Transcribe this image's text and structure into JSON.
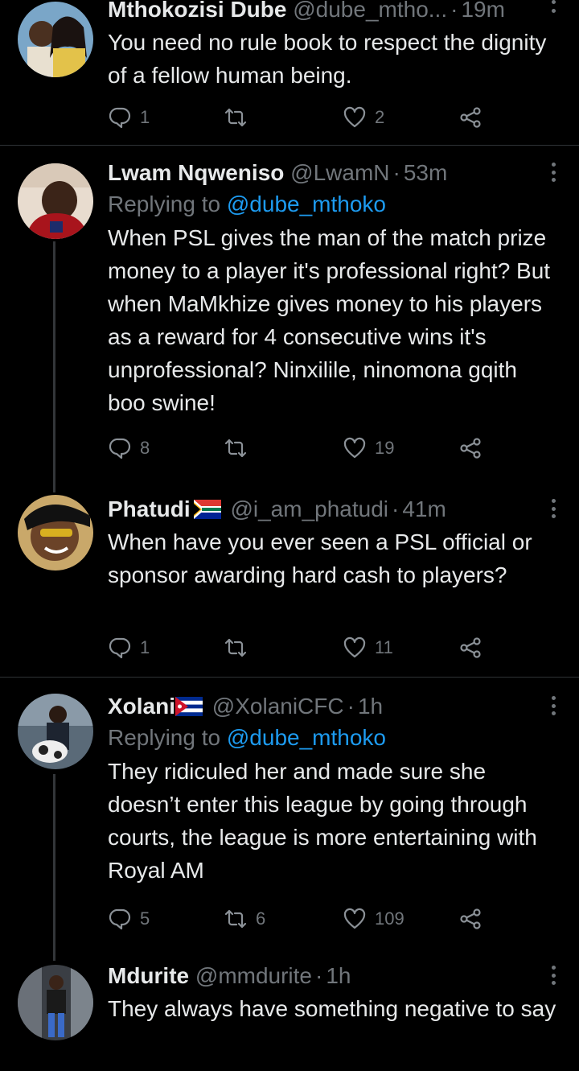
{
  "tweets": [
    {
      "name": "Mthokozisi Dube",
      "handle": "@dube_mtho...",
      "time": "19m",
      "reply_prefix": "",
      "reply_handle": "",
      "text": "You need no rule book to respect the dignity of a fellow human being.",
      "replies": "1",
      "retweets": "",
      "likes": "2"
    },
    {
      "name": "Lwam Nqweniso",
      "handle": "@LwamN",
      "time": "53m",
      "reply_prefix": "Replying to",
      "reply_handle": "@dube_mthoko",
      "text": "When PSL gives the man of the match prize money to a player it's professional right? But when MaMkhize gives money to his players as a reward for 4 consecutive wins it's unprofessional? Ninxilile, ninomona gqith boo swine!",
      "replies": "8",
      "retweets": "",
      "likes": "19"
    },
    {
      "name": "Phatudi",
      "handle": "@i_am_phatudi",
      "time": "41m",
      "reply_prefix": "",
      "reply_handle": "",
      "text": "When have you ever seen a PSL official or sponsor awarding hard cash to players?",
      "replies": "1",
      "retweets": "",
      "likes": "11"
    },
    {
      "name": "Xolani",
      "handle": "@XolaniCFC",
      "time": "1h",
      "reply_prefix": "Replying to",
      "reply_handle": "@dube_mthoko",
      "text": "They ridiculed her and made sure she doesn’t enter this league by going through courts, the league is more entertaining with Royal AM",
      "replies": "5",
      "retweets": "6",
      "likes": "109"
    },
    {
      "name": "Mdurite",
      "handle": "@mmdurite",
      "time": "1h",
      "reply_prefix": "",
      "reply_handle": "",
      "text": "They always have something negative to say",
      "replies": "",
      "retweets": "",
      "likes": ""
    }
  ],
  "separator": "·",
  "colors": {
    "background": "#000000",
    "text": "#e7e9ea",
    "muted": "#71767b",
    "link": "#1d9bf0",
    "divider": "#2f3336"
  },
  "icons": [
    "reply-icon",
    "retweet-icon",
    "like-icon",
    "share-icon",
    "more-icon",
    "south-africa-flag-icon",
    "cuba-flag-icon"
  ]
}
